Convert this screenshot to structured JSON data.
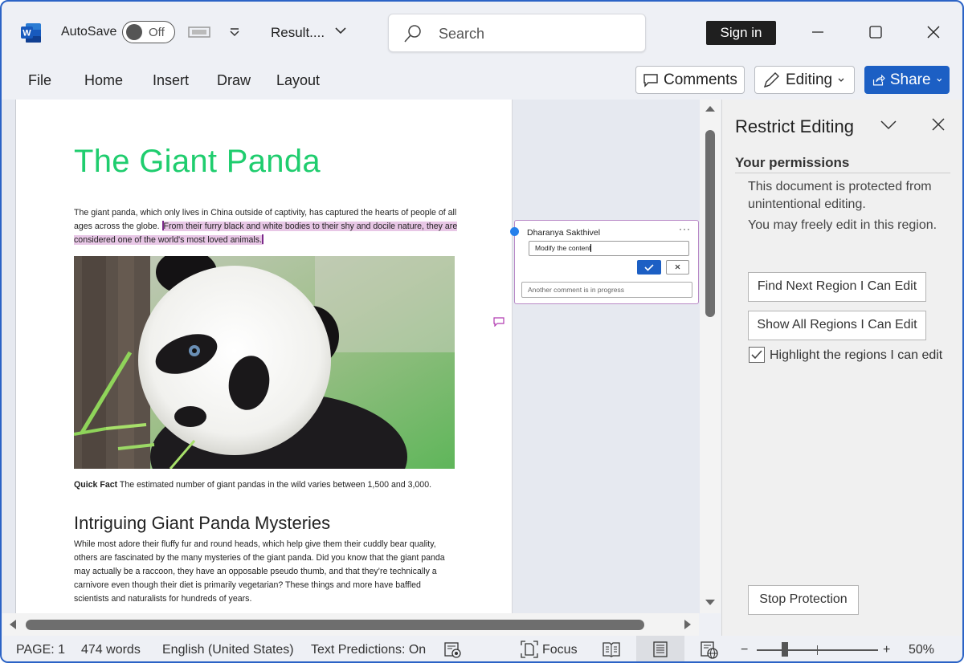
{
  "titlebar": {
    "app_icon": "word-logo-icon",
    "autosave_label": "AutoSave",
    "autosave_state": "Off",
    "document_name": "Result....",
    "search_placeholder": "Search",
    "sign_in_label": "Sign in"
  },
  "ribbon": {
    "tabs": [
      {
        "label": "File"
      },
      {
        "label": "Home"
      },
      {
        "label": "Insert"
      },
      {
        "label": "Draw"
      },
      {
        "label": "Layout"
      }
    ],
    "comments_label": "Comments",
    "editing_label": "Editing",
    "share_label": "Share",
    "share_color": "#1c5fc4"
  },
  "document": {
    "title": "The Giant Panda",
    "title_color": "#1fcd6e",
    "para1_plain": "The giant panda, which only lives in China outside of captivity, has captured the hearts of people of all ages across the globe. ",
    "para1_highlighted": "From their furry black and white bodies to their shy and docile nature, they are considered one of the world's most loved animals.",
    "highlight_color": "#e8c7e6",
    "image_alt": "Giant panda peeking from behind a tree trunk",
    "caption_bold": "Quick Fact",
    "caption_text": " The estimated number of giant pandas in the wild varies between 1,500 and 3,000.",
    "heading2": "Intriguing Giant Panda Mysteries",
    "para2": "While most adore their fluffy fur and round heads, which help give them their cuddly bear quality, others are fascinated by the many mysteries of the giant panda. Did you know that the giant panda may actually be a raccoon, they have an opposable pseudo thumb, and that they’re technically a carnivore even though their diet is primarily vegetarian? These things and more have baffled scientists and naturalists for hundreds of years."
  },
  "comment": {
    "author": "Dharanya Sakthivel",
    "more_label": "···",
    "input_value": "Modify the content",
    "reply_placeholder": "Another comment is in progress"
  },
  "restrict_pane": {
    "title": "Restrict Editing",
    "section": "Your permissions",
    "text1": "This document is protected from unintentional editing.",
    "text2": "You may freely edit in this region.",
    "find_next_label": "Find Next Region I Can Edit",
    "show_all_label": "Show All Regions I Can Edit",
    "highlight_label": "Highlight the regions I can edit",
    "highlight_checked": true,
    "stop_label": "Stop Protection"
  },
  "statusbar": {
    "page": "PAGE: 1",
    "words": "474 words",
    "language": "English (United States)",
    "predictions": "Text Predictions: On",
    "focus_label": "Focus",
    "zoom_minus": "−",
    "zoom_plus": "+",
    "zoom_level": "50%",
    "zoom_percent": 50
  }
}
